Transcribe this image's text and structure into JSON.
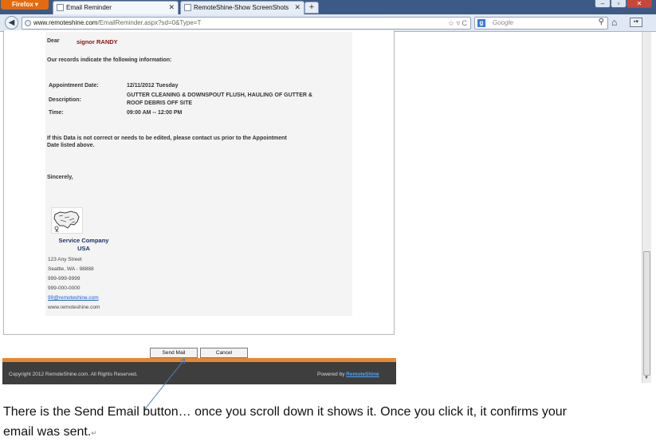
{
  "browser": {
    "firefox_label": "Firefox",
    "tabs": [
      {
        "title": "Email Reminder",
        "active": true
      },
      {
        "title": "RemoteShine-Show ScreenShots",
        "active": false
      }
    ],
    "new_tab_symbol": "+",
    "url_host": "www.remoteshine.com",
    "url_path": "/EmailReminder.aspx?sd=0&Type=T",
    "search_placeholder": "Google",
    "window_buttons": [
      "–",
      "▫",
      "✕"
    ]
  },
  "email": {
    "dear_label": "Dear",
    "recipient": "signor RANDY",
    "intro": "Our records indicate the following information:",
    "appointment_date_label": "Appointment Date:",
    "appointment_date_value": "12/11/2012 Tuesday",
    "description_label": "Description:",
    "description_line1": "GUTTER CLEANING & DOWNSPOUT FLUSH, HAULING OF GUTTER &",
    "description_line2": "ROOF DEBRIS OFF SITE",
    "time_label": "Time:",
    "time_value": "09:00 AM -- 12:00 PM",
    "notice_line1": "If this Data is not correct or needs to be edited, please contact us prior to the Appointment",
    "notice_line2": "Date listed above.",
    "closing": "Sincerely,",
    "company_line1": "Service Company",
    "company_line2": "USA",
    "address_lines": [
      "123 Any Street",
      "Seattle, WA - 98888",
      "999-999-9999",
      "999-000-0000"
    ],
    "email_link": "99@remoteshine.com",
    "website": "www.remoteshine.com"
  },
  "actions": {
    "send_label": "Send Mail",
    "cancel_label": "Cancel"
  },
  "footer": {
    "copyright": "Copyright 2012 RemoteShine.com. All Rights Reserved.",
    "powered_by": "Powered by",
    "brand": "RemoteShine"
  },
  "caption": {
    "line1": "There is the Send Email button… once you scroll down it shows it. Once you click it, it confirms your",
    "line2": "email was sent."
  },
  "colors": {
    "footer_orange": "#e9872e",
    "footer_dark": "#3e3e3e",
    "recipient_red": "#8b1212",
    "company_blue": "#1d2f6b"
  }
}
